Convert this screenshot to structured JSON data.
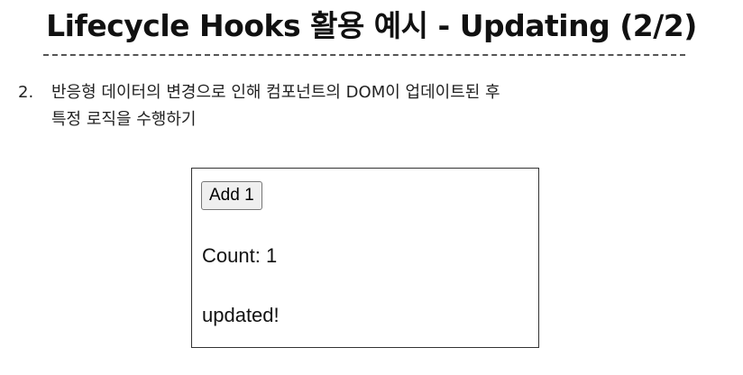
{
  "slide": {
    "title": "Lifecycle Hooks 활용 예시 - Updating (2/2)"
  },
  "list": {
    "number": "2.",
    "text": "반응형 데이터의 변경으로 인해 컴포넌트의 DOM이 업데이트된 후\n특정 로직을 수행하기"
  },
  "demo": {
    "button_label": "Add 1",
    "count_label": "Count:",
    "count_value": "1",
    "status_text": "updated!"
  }
}
